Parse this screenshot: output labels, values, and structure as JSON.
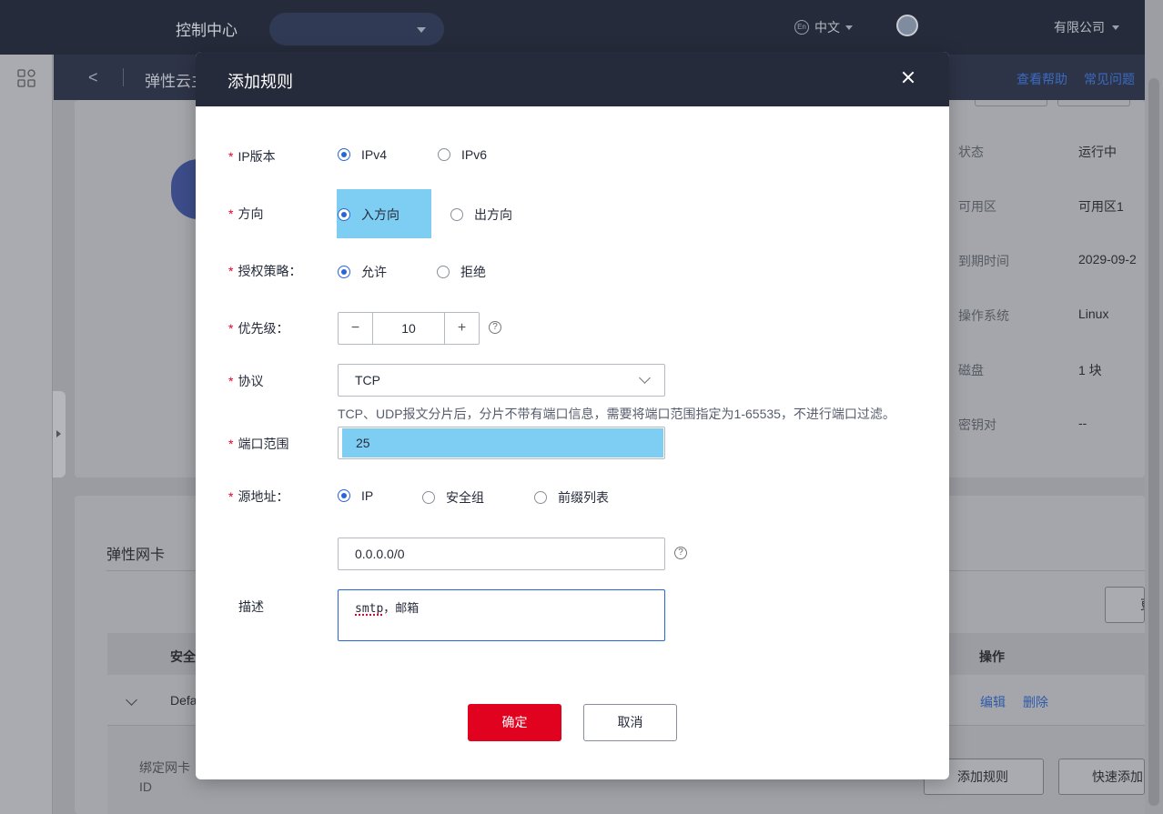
{
  "topbar": {
    "title": "控制中心",
    "language": "中文",
    "language_icon": "En",
    "company": "有限公司"
  },
  "subbar": {
    "breadcrumb": "弹性云主",
    "help": "查看帮助",
    "faq": "常见问题"
  },
  "instance_info": [
    {
      "key": "状态",
      "value": "运行中"
    },
    {
      "key": "可用区",
      "value": "可用区1"
    },
    {
      "key": "到期时间",
      "value": "2029-09-2"
    },
    {
      "key": "操作系统",
      "value": "Linux"
    },
    {
      "key": "磁盘",
      "value": "1 块"
    },
    {
      "key": "密钥对",
      "value": "--"
    }
  ],
  "nic": {
    "title": "弹性网卡",
    "col_security": "安全",
    "col_ops": "操作",
    "row_name": "Defa",
    "edit": "编辑",
    "delete": "删除",
    "bind_label_1": "绑定网卡",
    "bind_label_2": "ID",
    "btn_add_rule": "添加规则",
    "btn_quick_add": "快速添加",
    "btn_right": "更"
  },
  "modal": {
    "title": "添加规则",
    "ip_version": {
      "label": "IP版本",
      "options": [
        "IPv4",
        "IPv6"
      ],
      "selected": "IPv4"
    },
    "direction": {
      "label": "方向",
      "options": [
        "入方向",
        "出方向"
      ],
      "selected": "入方向"
    },
    "policy": {
      "label": "授权策略：",
      "options": [
        "允许",
        "拒绝"
      ],
      "selected": "允许"
    },
    "priority": {
      "label": "优先级：",
      "value": "10",
      "minus": "−",
      "plus": "+",
      "help_icon": "?"
    },
    "protocol": {
      "label": "协议",
      "value": "TCP",
      "hint": "TCP、UDP报文分片后，分片不带有端口信息，需要将端口范围指定为1-65535，不进行端口过滤。"
    },
    "port_range": {
      "label": "端口范围",
      "value": "25"
    },
    "source": {
      "label": "源地址：",
      "options": [
        "IP",
        "安全组",
        "前缀列表"
      ],
      "selected": "IP",
      "value": "0.0.0.0/0",
      "help_icon": "?"
    },
    "description": {
      "label": "描述",
      "value": "smtp，邮箱"
    },
    "confirm": "确定",
    "cancel": "取消"
  },
  "colors": {
    "header_bg": "#252b3a",
    "accent_blue": "#2a65d8",
    "confirm_red": "#e0021f",
    "highlight": "#7ecef4",
    "required": "#e6002d"
  }
}
